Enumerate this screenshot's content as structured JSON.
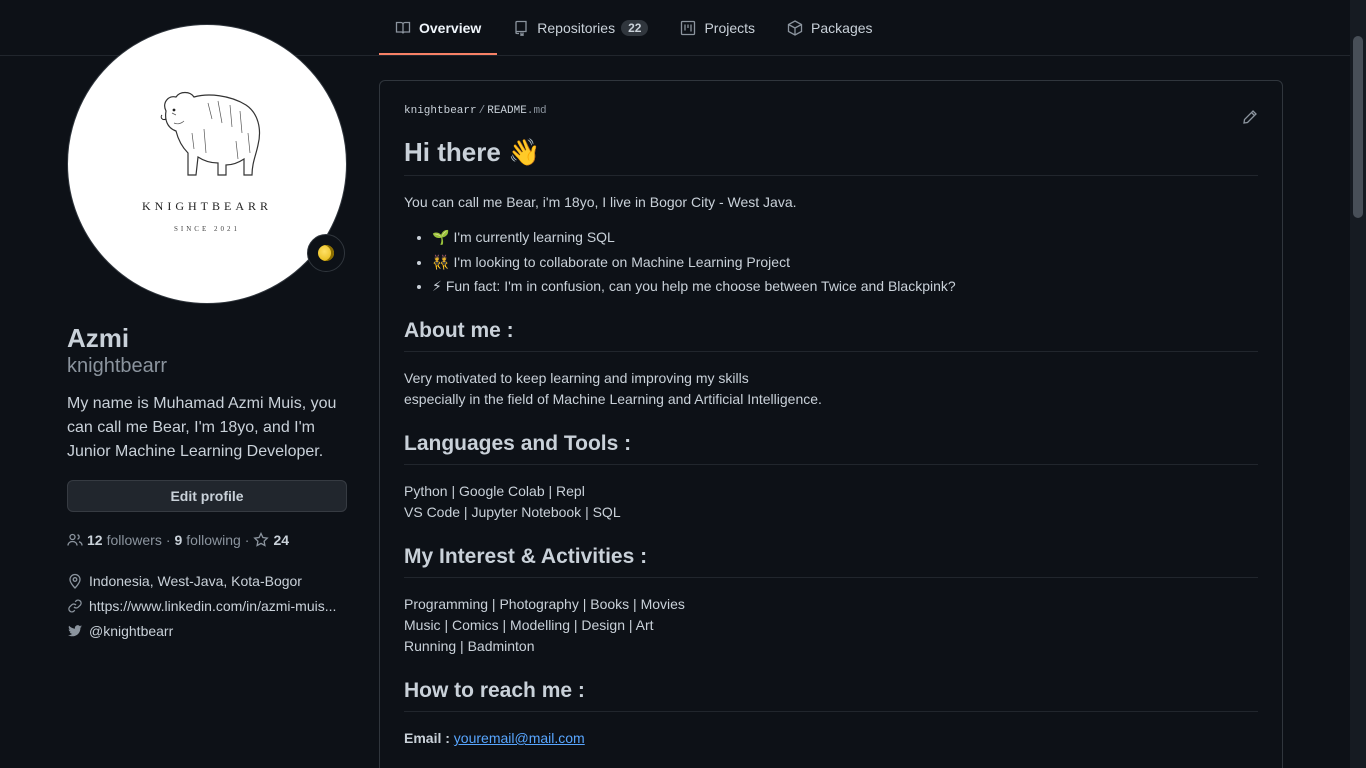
{
  "tabs": [
    {
      "label": "Overview",
      "icon": "book-icon"
    },
    {
      "label": "Repositories",
      "icon": "repo-icon",
      "count": "22"
    },
    {
      "label": "Projects",
      "icon": "project-icon"
    },
    {
      "label": "Packages",
      "icon": "package-icon"
    }
  ],
  "profile": {
    "avatar_text": "KNIGHTBEARR",
    "avatar_sub": "SINCE 2021",
    "fullname": "Azmi",
    "username": "knightbearr",
    "bio": "My name is Muhamad Azmi Muis, you can call me Bear, I'm 18yo, and I'm Junior Machine Learning Developer.",
    "edit_label": "Edit profile",
    "followers_count": "12",
    "followers_label": "followers",
    "following_count": "9",
    "following_label": "following",
    "stars": "24",
    "location": "Indonesia, West-Java, Kota-Bogor",
    "website": "https://www.linkedin.com/in/azmi-muis...",
    "twitter": "@knightbearr"
  },
  "readme": {
    "owner": "knightbearr",
    "file": "README",
    "ext": ".md",
    "title": "Hi there",
    "title_emoji": "👋",
    "intro": "You can call me Bear, i'm 18yo, I live in Bogor City - West Java.",
    "bullets": [
      {
        "emoji": "🌱",
        "text": "I'm currently learning SQL"
      },
      {
        "emoji": "👯",
        "text": "I'm looking to collaborate on Machine Learning Project"
      },
      {
        "emoji": "⚡",
        "text": "Fun fact: I'm in confusion, can you help me choose between Twice and Blackpink?"
      }
    ],
    "about_heading": "About me :",
    "about_lines": [
      "Very motivated to keep learning and improving my skills",
      "especially in the field of Machine Learning and Artificial Intelligence."
    ],
    "tools_heading": "Languages and Tools :",
    "tools_lines": [
      "Python | Google Colab | Repl",
      "VS Code | Jupyter Notebook | SQL"
    ],
    "interest_heading": "My Interest & Activities :",
    "interest_lines": [
      "Programming | Photography | Books | Movies",
      "Music | Comics | Modelling | Design | Art",
      "Running | Badminton"
    ],
    "reach_heading": "How to reach me :",
    "email_label": "Email :",
    "email": "youremail@mail.com"
  }
}
